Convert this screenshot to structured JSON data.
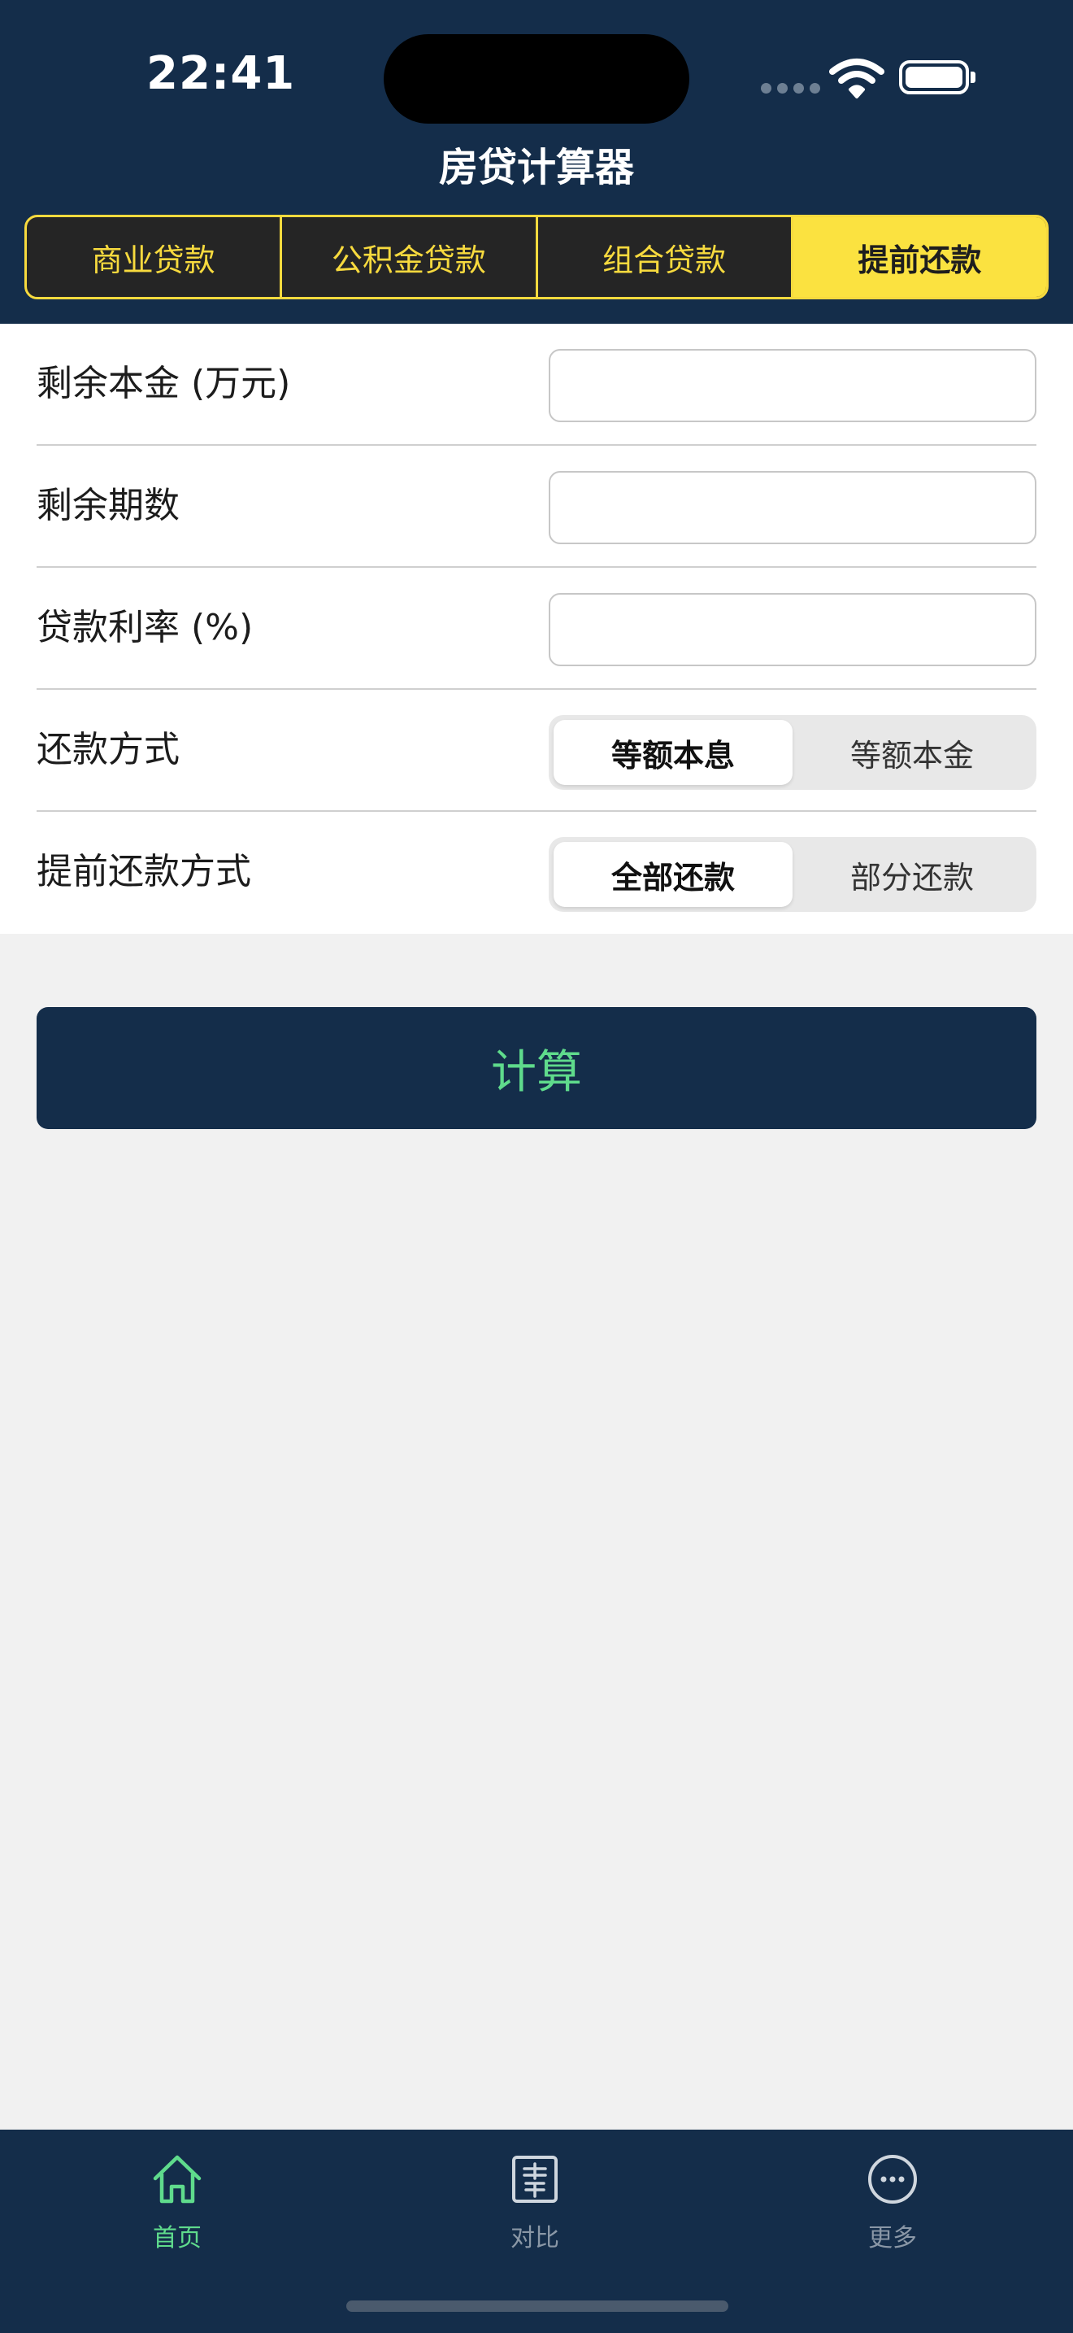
{
  "status_bar": {
    "time": "22:41"
  },
  "app": {
    "title": "房贷计算器"
  },
  "tabs": [
    {
      "label": "商业贷款",
      "active": false
    },
    {
      "label": "公积金贷款",
      "active": false
    },
    {
      "label": "组合贷款",
      "active": false
    },
    {
      "label": "提前还款",
      "active": true
    }
  ],
  "form": {
    "remaining_principal": {
      "label": "剩余本金 (万元)",
      "value": ""
    },
    "remaining_periods": {
      "label": "剩余期数",
      "value": ""
    },
    "interest_rate": {
      "label": "贷款利率 (%)",
      "value": ""
    },
    "repayment_method": {
      "label": "还款方式",
      "options": [
        "等额本息",
        "等额本金"
      ],
      "selected": "等额本息"
    },
    "prepay_method": {
      "label": "提前还款方式",
      "options": [
        "全部还款",
        "部分还款"
      ],
      "selected": "全部还款"
    }
  },
  "calculate_button": {
    "label": "计算"
  },
  "bottom_tabs": [
    {
      "label": "首页",
      "icon": "home-icon",
      "active": true
    },
    {
      "label": "对比",
      "icon": "compare-icon",
      "active": false
    },
    {
      "label": "更多",
      "icon": "more-icon",
      "active": false
    }
  ],
  "colors": {
    "header_bg": "#142d4a",
    "accent_yellow": "#fbe240",
    "accent_green": "#5fdb8c",
    "inactive_tab_label": "#8a97a6"
  }
}
